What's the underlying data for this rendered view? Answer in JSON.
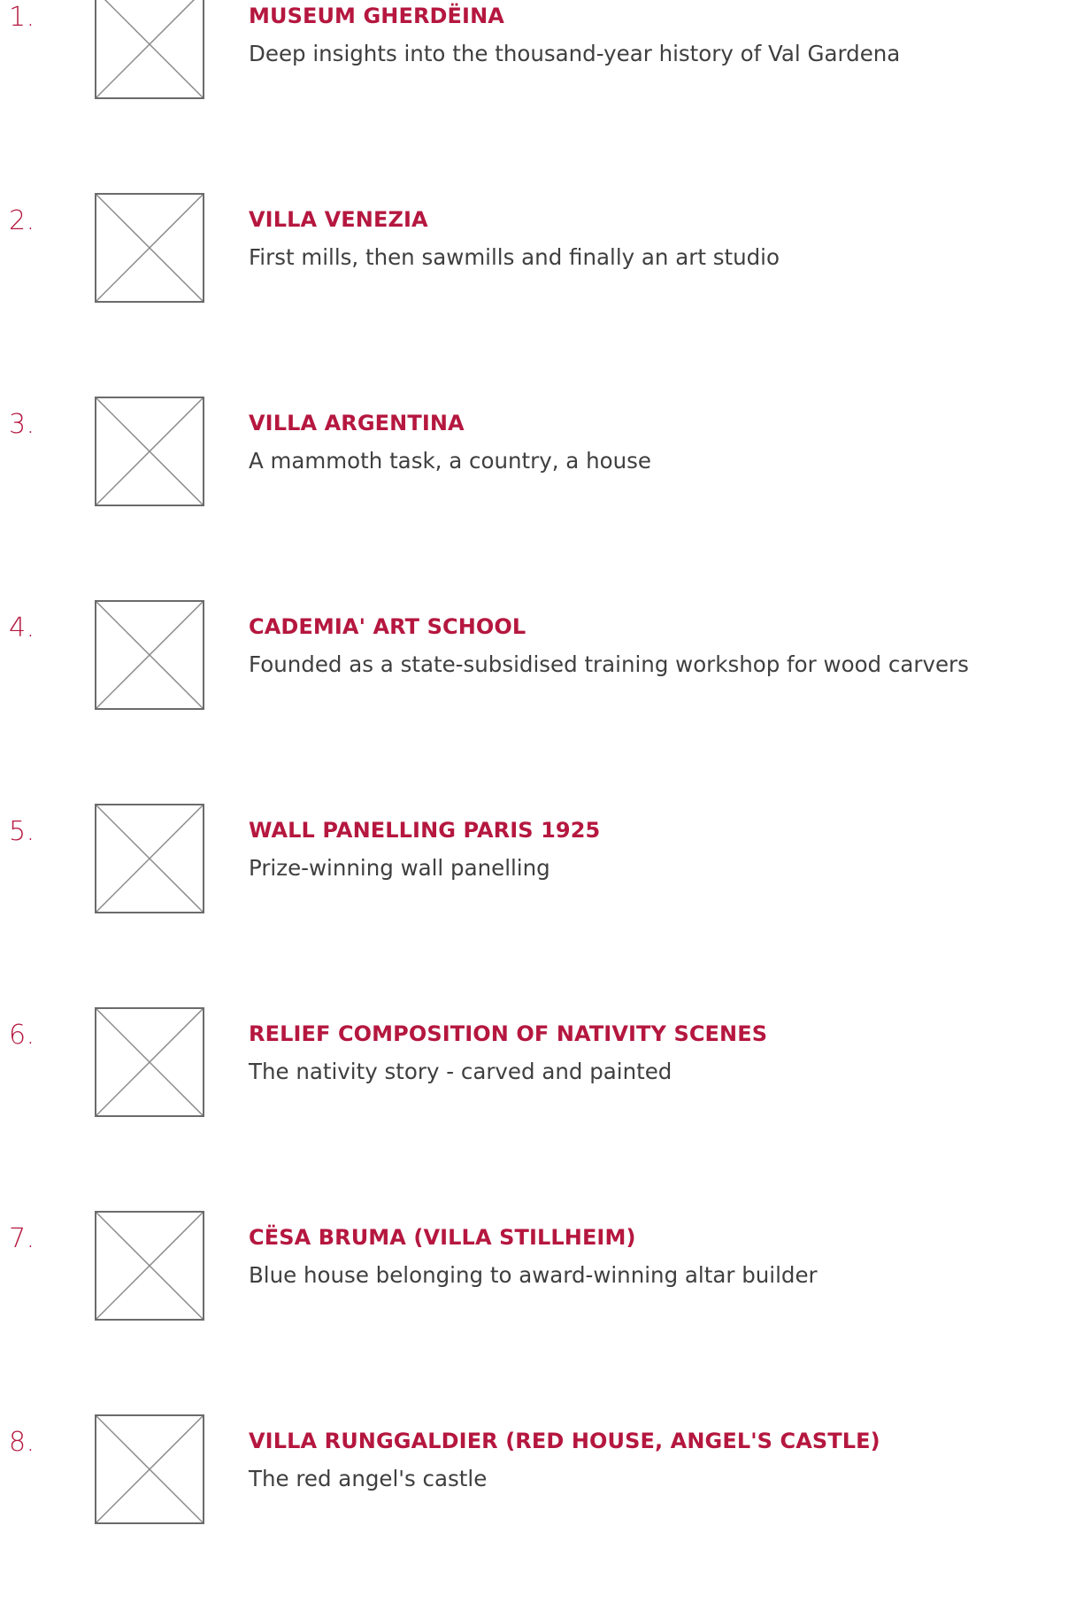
{
  "colors": {
    "accent": "#b5173f",
    "text": "#3f3f3f",
    "placeholder_stroke": "#6b6b6b"
  },
  "items": [
    {
      "number": "1.",
      "title": "MUSEUM GHERDËINA",
      "description": "Deep insights into the thousand-year history of Val Gardena",
      "image_icon": "broken-image-placeholder-icon"
    },
    {
      "number": "2.",
      "title": "VILLA VENEZIA",
      "description": "First mills, then sawmills and finally an art studio",
      "image_icon": "broken-image-placeholder-icon"
    },
    {
      "number": "3.",
      "title": "VILLA ARGENTINA",
      "description": "A mammoth task, a country, a house",
      "image_icon": "broken-image-placeholder-icon"
    },
    {
      "number": "4.",
      "title": "CADEMIA' ART SCHOOL",
      "description": "Founded as a state-subsidised training workshop for wood carvers",
      "image_icon": "broken-image-placeholder-icon"
    },
    {
      "number": "5.",
      "title": "WALL PANELLING PARIS 1925",
      "description": "Prize-winning wall panelling",
      "image_icon": "broken-image-placeholder-icon"
    },
    {
      "number": "6.",
      "title": "RELIEF COMPOSITION OF NATIVITY SCENES",
      "description": "The nativity story - carved and painted",
      "image_icon": "broken-image-placeholder-icon"
    },
    {
      "number": "7.",
      "title": "CËSA BRUMA (VILLA STILLHEIM)",
      "description": "Blue house belonging to award-winning altar builder",
      "image_icon": "broken-image-placeholder-icon"
    },
    {
      "number": "8.",
      "title": "VILLA RUNGGALDIER (RED HOUSE, ANGEL'S CASTLE)",
      "description": "The red angel's castle",
      "image_icon": "broken-image-placeholder-icon"
    }
  ]
}
